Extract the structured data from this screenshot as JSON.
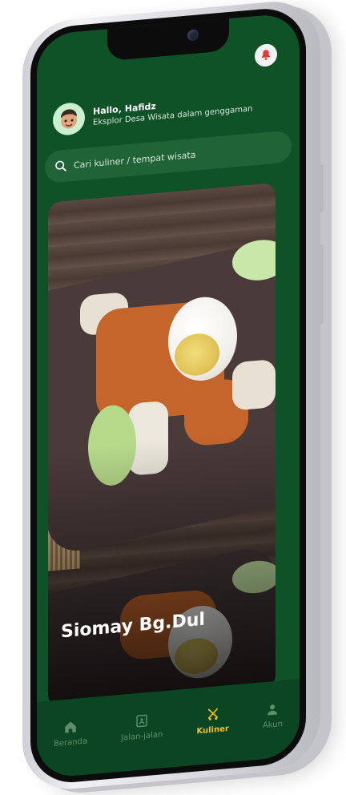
{
  "header": {
    "greeting_prefix": "Hallo, ",
    "greeting_name": "Hafidz",
    "subtitle": "Eksplor Desa Wisata dalam genggaman"
  },
  "search": {
    "placeholder": "Cari kuliner / tempat wisata"
  },
  "featured": {
    "title": "Siomay Bg.Dul"
  },
  "bottom_nav": {
    "items": [
      {
        "label": "Beranda",
        "icon": "home-icon",
        "active": false
      },
      {
        "label": "Jalan-jalan",
        "icon": "map-icon",
        "active": false
      },
      {
        "label": "Kuliner",
        "icon": "food-icon",
        "active": true
      },
      {
        "label": "Akun",
        "icon": "user-icon",
        "active": false
      }
    ]
  },
  "colors": {
    "screen_bg": "#0f5228",
    "nav_bg": "#0b4521",
    "active_accent": "#f2c026",
    "inactive_nav": "#5f8f6a",
    "bell_accent": "#e53935"
  }
}
